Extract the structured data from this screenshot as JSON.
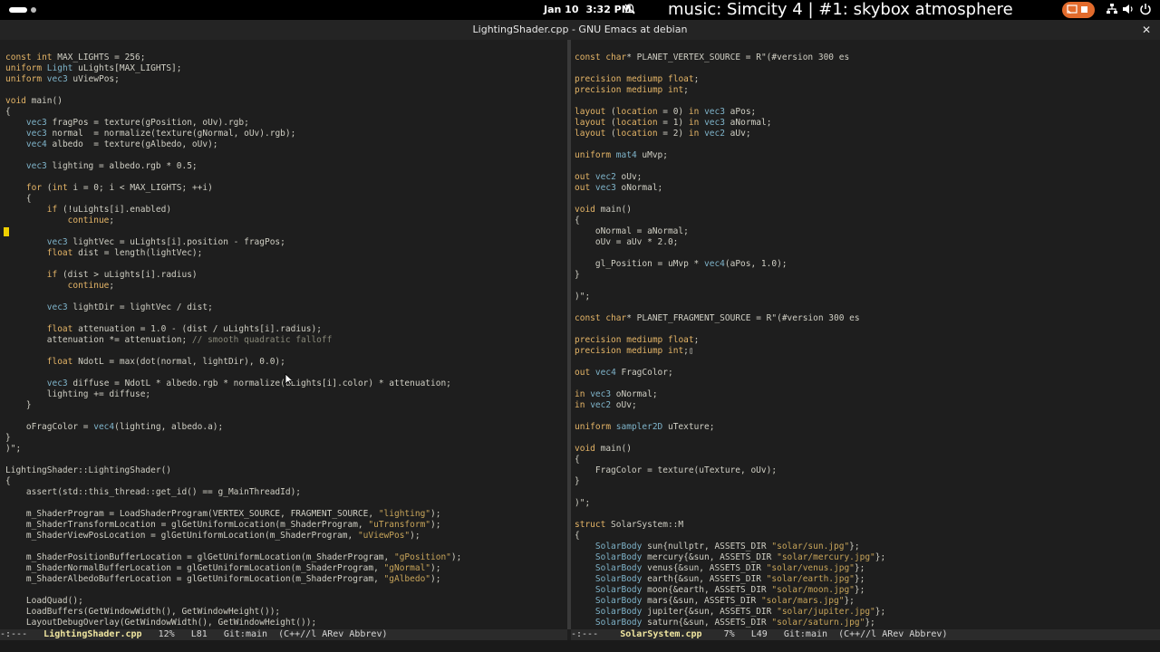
{
  "topbar": {
    "date": "Jan 10",
    "time": "3:32 PM",
    "music": "music: Simcity 4 | #1: skybox atmosphere",
    "icons": [
      "workspace-indicator",
      "do-not-disturb-icon",
      "screen-cast-icon",
      "network-icon",
      "volume-icon",
      "power-icon"
    ]
  },
  "window": {
    "title": "LightingShader.cpp - GNU Emacs at debian",
    "close_label": "✕"
  },
  "left": {
    "lines": [
      "const int MAX_LIGHTS = 256;",
      "uniform Light uLights[MAX_LIGHTS];",
      "uniform vec3 uViewPos;",
      "",
      "void main()",
      "{",
      "    vec3 fragPos = texture(gPosition, oUv).rgb;",
      "    vec3 normal  = normalize(texture(gNormal, oUv).rgb);",
      "    vec4 albedo  = texture(gAlbedo, oUv);",
      "",
      "    vec3 lighting = albedo.rgb * 0.5;",
      "",
      "    for (int i = 0; i < MAX_LIGHTS; ++i)",
      "    {",
      "        if (!uLights[i].enabled)",
      "            continue;",
      "",
      "        vec3 lightVec = uLights[i].position - fragPos;",
      "        float dist = length(lightVec);",
      "",
      "        if (dist > uLights[i].radius)",
      "            continue;",
      "",
      "        vec3 lightDir = lightVec / dist;",
      "",
      "        float attenuation = 1.0 - (dist / uLights[i].radius);",
      "        attenuation *= attenuation; // smooth quadratic falloff",
      "",
      "        float NdotL = max(dot(normal, lightDir), 0.0);",
      "",
      "        vec3 diffuse = NdotL * albedo.rgb * normalize(uLights[i].color) * attenuation;",
      "        lighting += diffuse;",
      "    }",
      "",
      "    oFragColor = vec4(lighting, albedo.a);",
      "}",
      ")\";",
      "",
      "LightingShader::LightingShader()",
      "{",
      "    assert(std::this_thread::get_id() == g_MainThreadId);",
      "",
      "    m_ShaderProgram = LoadShaderProgram(VERTEX_SOURCE, FRAGMENT_SOURCE, \"lighting\");",
      "    m_ShaderTransformLocation = glGetUniformLocation(m_ShaderProgram, \"uTransform\");",
      "    m_ShaderViewPosLocation = glGetUniformLocation(m_ShaderProgram, \"uViewPos\");",
      "",
      "    m_ShaderPositionBufferLocation = glGetUniformLocation(m_ShaderProgram, \"gPosition\");",
      "    m_ShaderNormalBufferLocation = glGetUniformLocation(m_ShaderProgram, \"gNormal\");",
      "    m_ShaderAlbedoBufferLocation = glGetUniformLocation(m_ShaderProgram, \"gAlbedo\");",
      "",
      "    LoadQuad();",
      "    LoadBuffers(GetWindowWidth(), GetWindowHeight());",
      "    LayoutDebugOverlay(GetWindowWidth(), GetWindowHeight());"
    ],
    "modeline": {
      "status": "-:---",
      "buffer": "LightingShader.cpp",
      "percent": "12%",
      "line": "L81",
      "vc": "Git:main",
      "modes": "(C++//l ARev Abbrev)"
    }
  },
  "right": {
    "lines": [
      "const char* PLANET_VERTEX_SOURCE = R\"(#version 300 es",
      "",
      "precision mediump float;",
      "precision mediump int;",
      "",
      "layout (location = 0) in vec3 aPos;",
      "layout (location = 1) in vec3 aNormal;",
      "layout (location = 2) in vec2 aUv;",
      "",
      "uniform mat4 uMvp;",
      "",
      "out vec2 oUv;",
      "out vec3 oNormal;",
      "",
      "void main()",
      "{",
      "    oNormal = aNormal;",
      "    oUv = aUv * 2.0;",
      "",
      "    gl_Position = uMvp * vec4(aPos, 1.0);",
      "}",
      "",
      ")\";",
      "",
      "const char* PLANET_FRAGMENT_SOURCE = R\"(#version 300 es",
      "",
      "precision mediump float;",
      "precision mediump int;▯",
      "",
      "out vec4 FragColor;",
      "",
      "in vec3 oNormal;",
      "in vec2 oUv;",
      "",
      "uniform sampler2D uTexture;",
      "",
      "void main()",
      "{",
      "    FragColor = texture(uTexture, oUv);",
      "}",
      "",
      ")\";",
      "",
      "struct SolarSystem::M",
      "{",
      "    SolarBody sun{nullptr, ASSETS_DIR \"solar/sun.jpg\"};",
      "    SolarBody mercury{&sun, ASSETS_DIR \"solar/mercury.jpg\"};",
      "    SolarBody venus{&sun, ASSETS_DIR \"solar/venus.jpg\"};",
      "    SolarBody earth{&sun, ASSETS_DIR \"solar/earth.jpg\"};",
      "    SolarBody moon{&earth, ASSETS_DIR \"solar/moon.jpg\"};",
      "    SolarBody mars{&sun, ASSETS_DIR \"solar/mars.jpg\"};",
      "    SolarBody jupiter{&sun, ASSETS_DIR \"solar/jupiter.jpg\"};",
      "    SolarBody saturn{&sun, ASSETS_DIR \"solar/saturn.jpg\"};"
    ],
    "modeline": {
      "status": "-:---",
      "buffer": "SolarSystem.cpp",
      "percent": "7%",
      "line": "L49",
      "vc": "Git:main",
      "modes": "(C++//l ARev Abbrev)"
    }
  },
  "colors": {
    "background": "#1e1e1e",
    "keyword": "#e5b567",
    "type": "#7fb4ca",
    "string": "#c8a55a",
    "accent_cast": "#e26b2c",
    "cursor": "#f0d000"
  }
}
